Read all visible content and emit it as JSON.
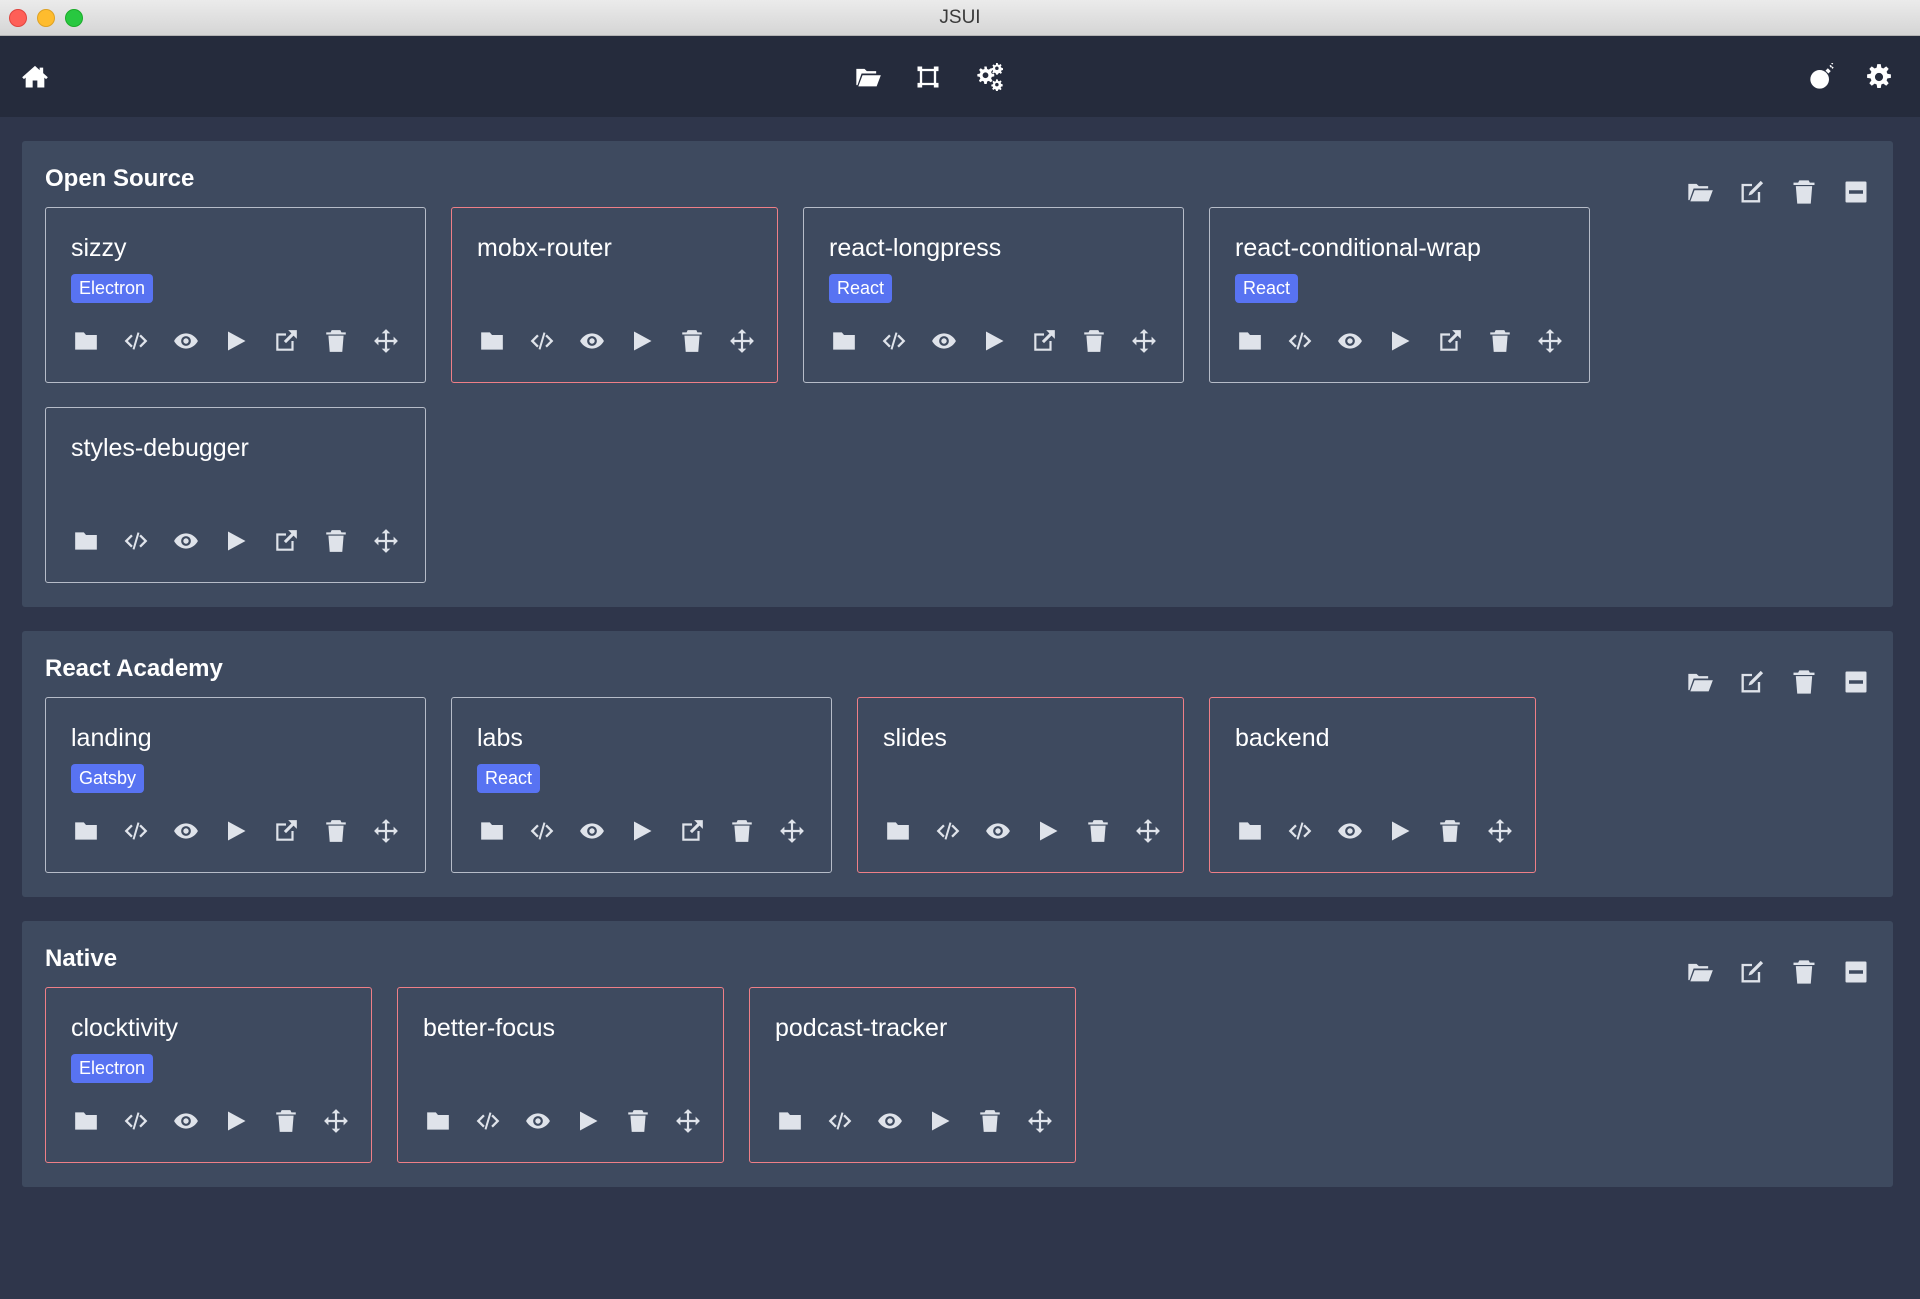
{
  "window": {
    "title": "JSUI"
  },
  "toolbar": {
    "left": [
      {
        "icon": "home-icon"
      }
    ],
    "center": [
      {
        "icon": "folder-open-icon"
      },
      {
        "icon": "crop-icon"
      },
      {
        "icon": "gears-icon"
      }
    ],
    "right": [
      {
        "icon": "bomb-icon"
      },
      {
        "icon": "gear-icon"
      }
    ]
  },
  "colors": {
    "background": "#2f364b",
    "group": "#3e4a5f",
    "toolbar": "#252b3c",
    "badge": "#5873f2",
    "alert_border": "#ef7f87",
    "normal_border": "#b6bcc8"
  },
  "groups": [
    {
      "title": "Open Source",
      "projects": [
        {
          "name": "sizzy",
          "badge": "Electron",
          "alert": false,
          "external": true
        },
        {
          "name": "mobx-router",
          "badge": "",
          "alert": true,
          "external": false
        },
        {
          "name": "react-longpress",
          "badge": "React",
          "alert": false,
          "external": true
        },
        {
          "name": "react-conditional-wrap",
          "badge": "React",
          "alert": false,
          "external": true
        },
        {
          "name": "styles-debugger",
          "badge": "",
          "alert": false,
          "external": true
        }
      ]
    },
    {
      "title": "React Academy",
      "projects": [
        {
          "name": "landing",
          "badge": "Gatsby",
          "alert": false,
          "external": true
        },
        {
          "name": "labs",
          "badge": "React",
          "alert": false,
          "external": true
        },
        {
          "name": "slides",
          "badge": "",
          "alert": true,
          "external": false
        },
        {
          "name": "backend",
          "badge": "",
          "alert": true,
          "external": false
        }
      ]
    },
    {
      "title": "Native",
      "projects": [
        {
          "name": "clocktivity",
          "badge": "Electron",
          "alert": true,
          "external": false
        },
        {
          "name": "better-focus",
          "badge": "",
          "alert": true,
          "external": false
        },
        {
          "name": "podcast-tracker",
          "badge": "",
          "alert": true,
          "external": false
        }
      ]
    }
  ]
}
